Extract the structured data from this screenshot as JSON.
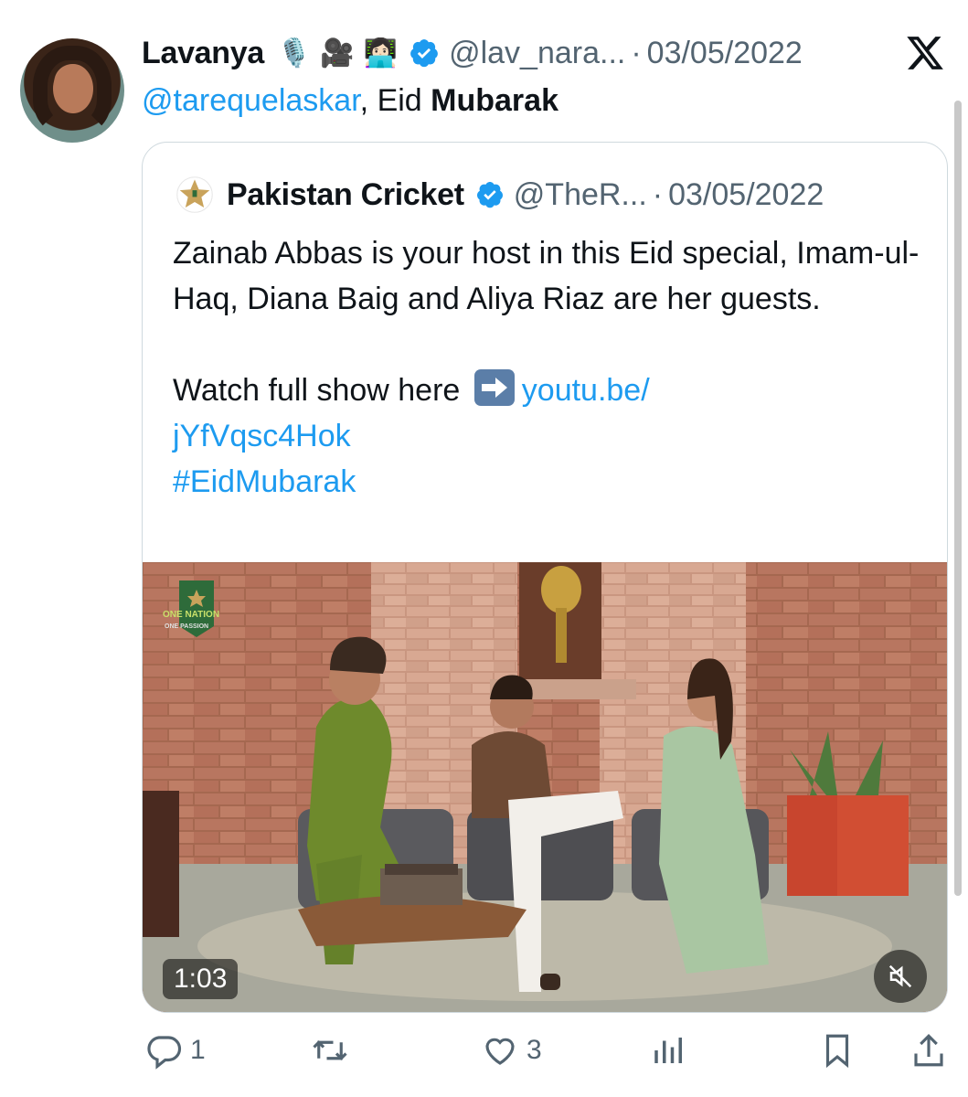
{
  "tweet": {
    "author_name": "Lavanya",
    "author_emojis": [
      "🎙️",
      "🎥",
      "👩🏻‍💻"
    ],
    "handle": "@lav_nara...",
    "separator": "·",
    "date": "03/05/2022",
    "reply_mention": "@tarequelaskar",
    "reply_comma": ",",
    "reply_word": "Eid",
    "reply_bold": "Mubarak"
  },
  "quote": {
    "author_name": "Pakistan Cricket",
    "handle": "@TheR...",
    "separator": "·",
    "date": "03/05/2022",
    "line1": "Zainab Abbas is your host in this Eid special, Imam-ul-Haq, Diana Baig and Aliya Riaz are her guests.",
    "watch_text": "Watch full show here",
    "link_text": "youtu.be/",
    "link_text2": "jYfVqsc4Hok",
    "hashtag": "#EidMubarak",
    "video": {
      "duration": "1:03",
      "overlay_line1": "ONE NATION",
      "overlay_line2": "ONE PASSION"
    }
  },
  "actions": {
    "reply_count": "1",
    "retweet_count": "",
    "like_count": "3"
  },
  "icons": {
    "verified": "verified-badge-icon",
    "platform": "x-logo-icon",
    "reply": "reply-icon",
    "retweet": "retweet-icon",
    "like": "heart-icon",
    "views": "views-icon",
    "bookmark": "bookmark-icon",
    "share": "share-icon",
    "mute": "muted-speaker-icon"
  },
  "colors": {
    "accent": "#1d9bf0",
    "secondary_text": "#536471",
    "border": "#cfd9de"
  }
}
